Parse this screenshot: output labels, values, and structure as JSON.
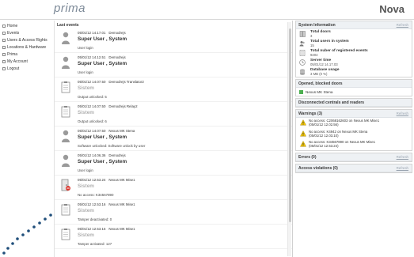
{
  "header": {
    "logo": "prima",
    "brand": "Nova"
  },
  "sidebar": {
    "items": [
      {
        "label": "Home"
      },
      {
        "label": "Events"
      },
      {
        "label": "Users & Access Rights"
      },
      {
        "label": "Locations & Hardware"
      },
      {
        "label": "Prima"
      },
      {
        "label": "My Account"
      },
      {
        "label": "Logout"
      }
    ]
  },
  "main": {
    "title": "Last events",
    "events": [
      {
        "date": "05/01/12 14.17.01",
        "source": "Demodrejs",
        "title": "Super User , System",
        "desc": "User login",
        "icon": "user-icon"
      },
      {
        "date": "05/01/12 14.12.51",
        "source": "Demodrejs",
        "title": "Super User , System",
        "desc": "User login",
        "icon": "user-icon"
      },
      {
        "date": "05/01/12 14.07.50",
        "source": "Demodrejs Translator2",
        "title": "Sistem",
        "desc": "Output unlocked: 5",
        "icon": "clipboard-icon"
      },
      {
        "date": "05/01/12 14.07.50",
        "source": "Demodrejs Relay2",
        "title": "Sistem",
        "desc": "Output unlocked: 6",
        "icon": "clipboard-icon"
      },
      {
        "date": "05/01/12 14.07.50",
        "source": "Nexus MK Stena",
        "title": "Super User , System",
        "desc": "Software unlocked: Software unlock by user",
        "icon": "user-icon"
      },
      {
        "date": "05/01/12 14.06.36",
        "source": "Demodrejs",
        "title": "Super User , System",
        "desc": "User login",
        "icon": "user-icon"
      },
      {
        "date": "05/01/12 12.53.24",
        "source": "Nexus MK Mise1",
        "title": "Sistem",
        "desc": "No access: K34567890",
        "icon": "door-no-access-icon"
      },
      {
        "date": "05/01/12 12.53.16",
        "source": "Nexus MK Mise1",
        "title": "Sistem",
        "desc": "Tamper deactivated: 0",
        "icon": "clipboard-icon"
      },
      {
        "date": "05/01/12 12.53.16",
        "source": "Nexus MK Mise1",
        "title": "Sistem",
        "desc": "Tamper activated: 127",
        "icon": "clipboard-icon"
      }
    ]
  },
  "right": {
    "system_info": {
      "title": "System Information",
      "refresh": "Refresh",
      "stats": [
        {
          "label": "Total doors",
          "value": "3",
          "icon": "doors-icon"
        },
        {
          "label": "Total users in system",
          "value": "15",
          "icon": "users-icon"
        },
        {
          "label": "Total nuber of registered events",
          "value": "9204",
          "icon": "events-icon"
        },
        {
          "label": "Server time",
          "value": "05/01/12 14.17.03",
          "icon": "clock-icon"
        },
        {
          "label": "Database usage",
          "value": "3 MB (0 %)",
          "icon": "database-icon"
        }
      ]
    },
    "opened_doors": {
      "title": "Opened, blocked doors",
      "items": [
        "Nexus MK Stena"
      ]
    },
    "disconnected": {
      "title": "Disconnected centrals and readers"
    },
    "warnings": {
      "title": "Warnings (3)",
      "refresh": "Refresh",
      "items": [
        {
          "line1": "No access: C2068162603 on Nexus MK Mise1",
          "line2": "(05/01/12 12.02.56)"
        },
        {
          "line1": "No access: K4942 on Nexus MK Stena",
          "line2": "(05/01/12 12.03.10)"
        },
        {
          "line1": "No access: K34567890 on Nexus MK Mise1",
          "line2": "(05/01/12 12.53.24)"
        }
      ]
    },
    "errors": {
      "title": "Errors (0)",
      "refresh": "Refresh"
    },
    "violations": {
      "title": "Access violations (0)",
      "refresh": "Refresh"
    }
  },
  "colors": {
    "system_title": "#b0b0b0",
    "panel_head": "#eef1f4",
    "warning": "#f0c400",
    "open_door": "#4caf50"
  }
}
